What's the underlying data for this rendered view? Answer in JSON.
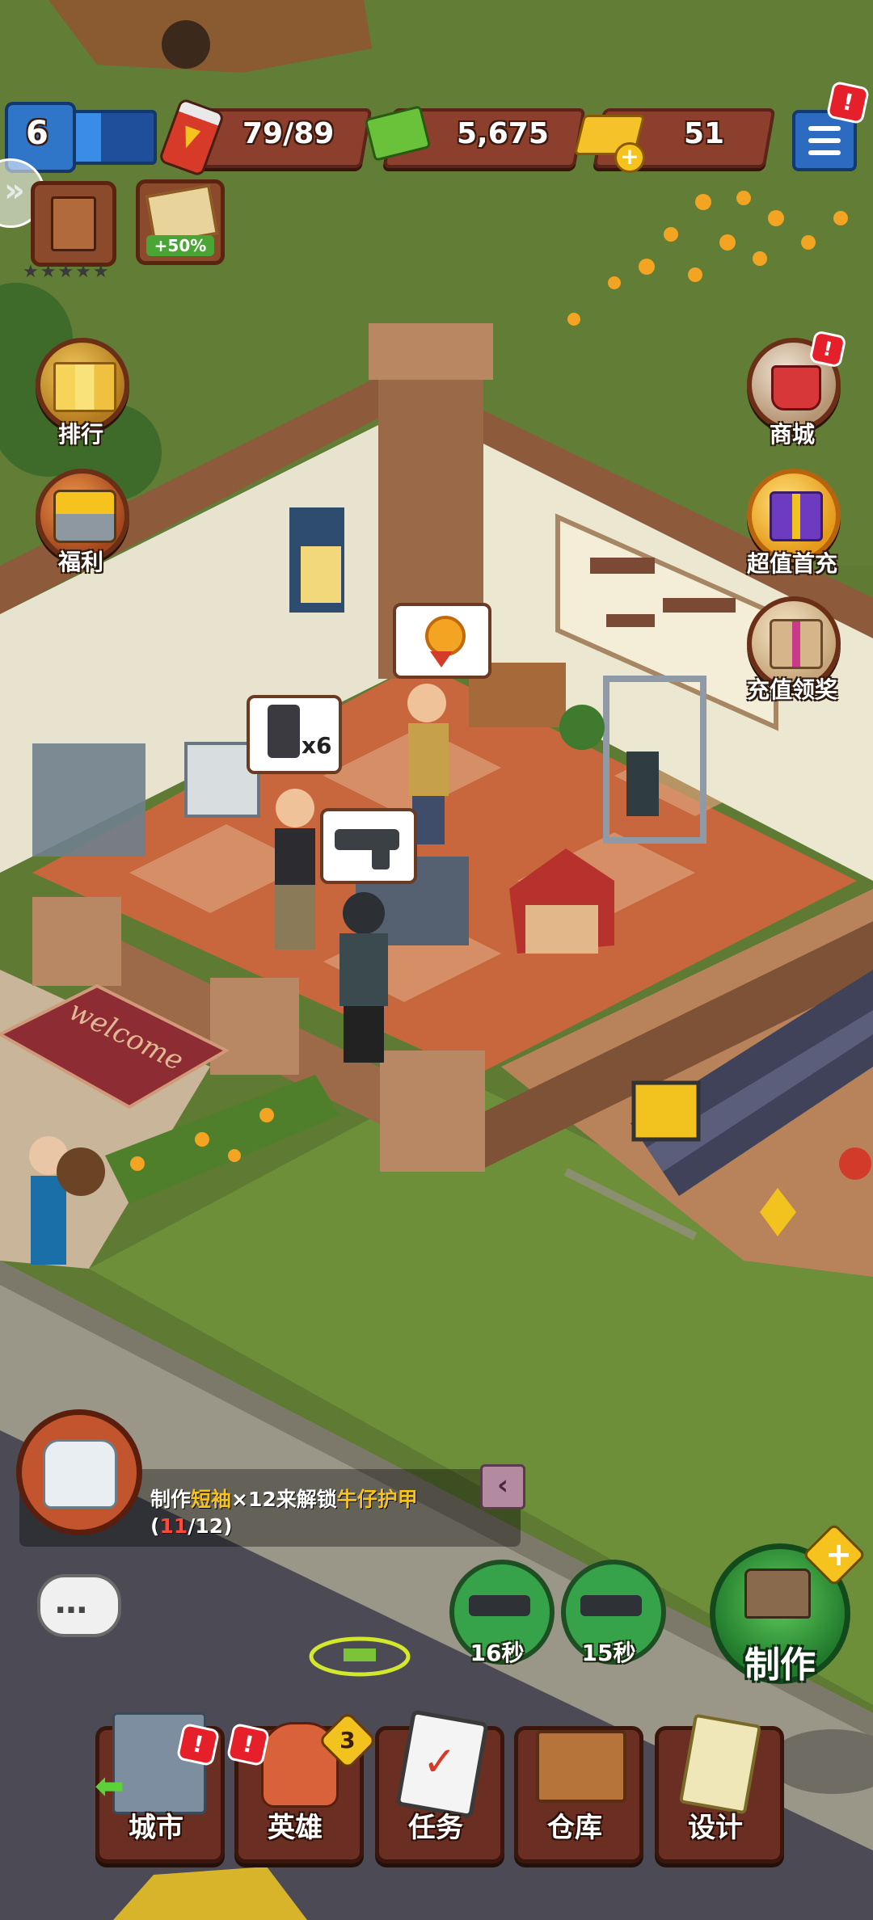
{
  "hud": {
    "level": "6",
    "energy": "79/89",
    "cash": "5,675",
    "gold": "51",
    "shop_bonus": "+50%",
    "menu_alert": "!"
  },
  "left_menu": {
    "rank_label": "排行",
    "welfare_label": "福利"
  },
  "right_menu": {
    "shop_label": "商城",
    "first_recharge_label": "超值首充",
    "recharge_reward_label": "充值领奖",
    "shop_alert": "!"
  },
  "scene": {
    "order_quantity": "x6",
    "welcome_mat": "welcome"
  },
  "hint": {
    "prefix": "制作",
    "item": "短袖",
    "count": "×12",
    "middle": "来解锁",
    "unlock_item": "牛仔护甲",
    "progress_open": "(",
    "progress_current": "11",
    "progress_rest": "/12)"
  },
  "craft_slots": [
    {
      "time": "16秒"
    },
    {
      "time": "15秒"
    }
  ],
  "craft_button": {
    "label": "制作",
    "plus": "+"
  },
  "bottom_nav": {
    "city": "城市",
    "heroes": "英雄",
    "heroes_badge": "3",
    "tasks": "任务",
    "warehouse": "仓库",
    "design": "设计",
    "alert": "!"
  },
  "colors": {
    "grass": "#5f7a33",
    "hud_panel": "#8c3f2c",
    "level_blue": "#2f76c9",
    "craft_green": "#36a34a",
    "highlight": "#f6c21d",
    "alert_red": "#e5202a"
  }
}
